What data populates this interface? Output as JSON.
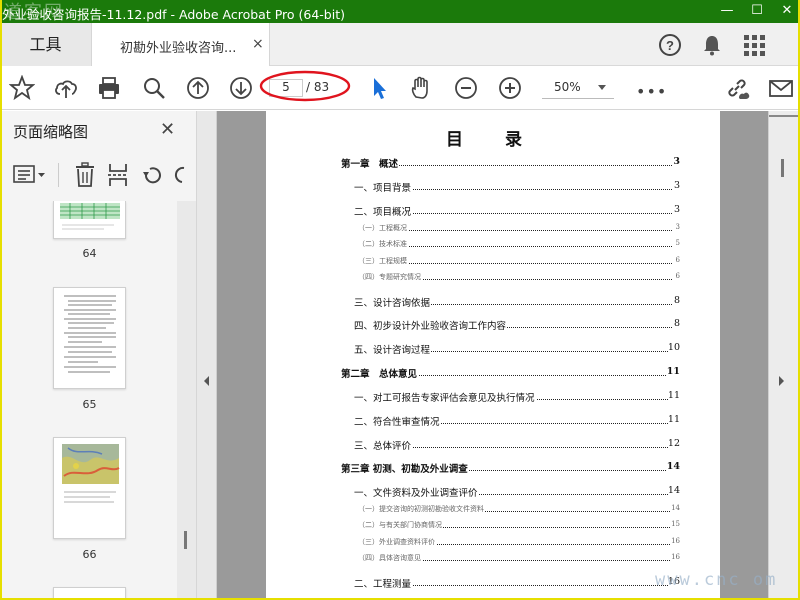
{
  "window": {
    "title": "外业验收咨询报告-11.12.pdf - Adobe Acrobat Pro (64-bit)",
    "watermark_top": "道客网",
    "minimize": "—",
    "maximize": "☐",
    "close": "✕"
  },
  "tabs": {
    "tools_label": "工具",
    "doc_label": "初勘外业验收咨询...",
    "doc_close": "×"
  },
  "toolbar": {
    "current_page": "5",
    "total_pages": "/ 83",
    "zoom": "50%",
    "more": "•••",
    "highlight_color": "#e0141e"
  },
  "sidebar": {
    "title": "页面缩略图",
    "close": "✕",
    "thumbnails": [
      {
        "page": "64"
      },
      {
        "page": "65"
      },
      {
        "page": "66"
      }
    ]
  },
  "toc": {
    "title": "目 录",
    "entries": [
      {
        "level": 1,
        "text": "第一章　概述",
        "page": "3"
      },
      {
        "level": 2,
        "text": "一、项目背景",
        "page": "3"
      },
      {
        "level": 2,
        "text": "二、项目概况",
        "page": "3"
      },
      {
        "level": 3,
        "text": "（一）工程概况",
        "page": "3"
      },
      {
        "level": 3,
        "text": "（二）技术标准",
        "page": "5"
      },
      {
        "level": 3,
        "text": "（三）工程规模",
        "page": "6"
      },
      {
        "level": 3,
        "text": "（四）专题研究情况",
        "page": "6"
      },
      {
        "level": 2,
        "text": "三、设计咨询依据",
        "page": "8"
      },
      {
        "level": 2,
        "text": "四、初步设计外业验收咨询工作内容",
        "page": "8"
      },
      {
        "level": 2,
        "text": "五、设计咨询过程",
        "page": "10"
      },
      {
        "level": 1,
        "text": "第二章　总体意见",
        "page": "11"
      },
      {
        "level": 2,
        "text": "一、对工可报告专家评估会意见及执行情况",
        "page": "11"
      },
      {
        "level": 2,
        "text": "二、符合性审查情况",
        "page": "11"
      },
      {
        "level": 2,
        "text": "三、总体评价",
        "page": "12"
      },
      {
        "level": 1,
        "text": "第三章 初测、初勘及外业调查",
        "page": "14"
      },
      {
        "level": 2,
        "text": "一、文件资料及外业调查评价",
        "page": "14"
      },
      {
        "level": 3,
        "text": "（一）提交咨询的初测初勘验收文件资料",
        "page": "14"
      },
      {
        "level": 3,
        "text": "（二）与有关部门协商情况",
        "page": "15"
      },
      {
        "level": 3,
        "text": "（三）外业调查资料评价",
        "page": "16"
      },
      {
        "level": 3,
        "text": "（四）具体咨询意见",
        "page": "16"
      },
      {
        "level": 2,
        "text": "二、工程测量",
        "page": "16"
      }
    ]
  },
  "watermark_bottom": "www.cnc  om"
}
